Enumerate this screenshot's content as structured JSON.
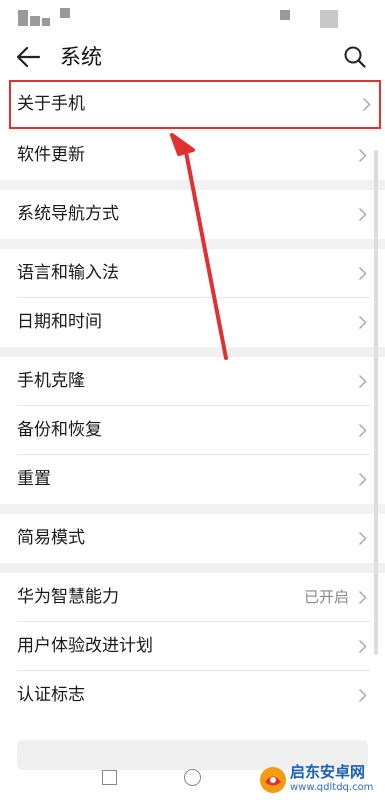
{
  "header": {
    "title": "系统",
    "back_icon": "back-arrow-icon",
    "search_icon": "search-icon"
  },
  "groups": [
    {
      "items": [
        {
          "label": "关于手机",
          "highlighted": true
        },
        {
          "label": "软件更新"
        }
      ]
    },
    {
      "items": [
        {
          "label": "系统导航方式"
        }
      ]
    },
    {
      "items": [
        {
          "label": "语言和输入法"
        },
        {
          "label": "日期和时间"
        }
      ]
    },
    {
      "items": [
        {
          "label": "手机克隆"
        },
        {
          "label": "备份和恢复"
        },
        {
          "label": "重置"
        }
      ]
    },
    {
      "items": [
        {
          "label": "简易模式"
        }
      ]
    },
    {
      "items": [
        {
          "label": "华为智慧能力",
          "value": "已开启"
        },
        {
          "label": "用户体验改进计划"
        },
        {
          "label": "认证标志"
        }
      ]
    }
  ],
  "annotation": {
    "color": "#e03030"
  },
  "navbar": {
    "icons": [
      "recent-apps-icon",
      "home-icon"
    ]
  },
  "watermark": {
    "name": "启东安卓网",
    "url": "www.qdltdq.com"
  }
}
